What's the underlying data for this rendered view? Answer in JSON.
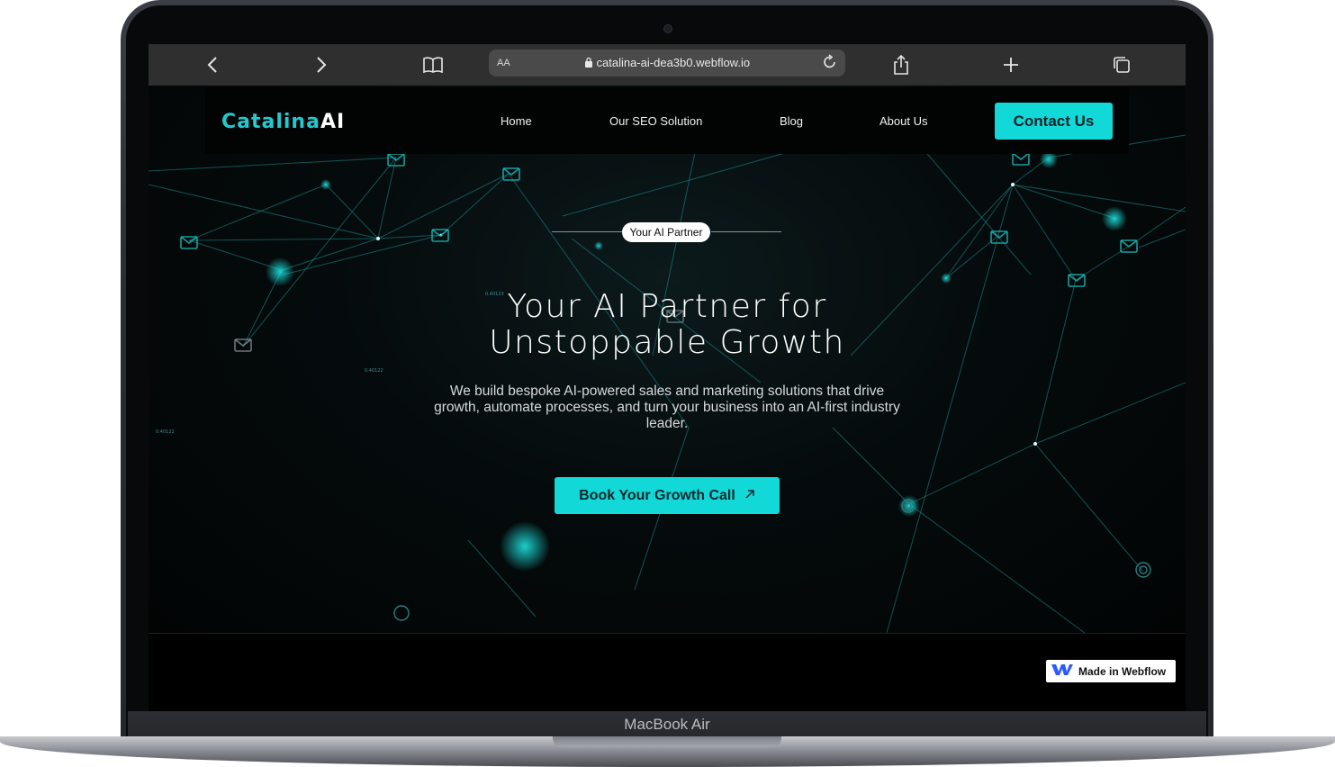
{
  "device": {
    "label": "MacBook Air"
  },
  "browser": {
    "url": "catalina-ai-dea3b0.webflow.io",
    "text_size_label": "AA",
    "icons": [
      "back-icon",
      "forward-icon",
      "bookmarks-icon",
      "lock-icon",
      "reload-icon",
      "share-icon",
      "new-tab-icon",
      "tabs-icon"
    ]
  },
  "nav": {
    "logo_text_1": "Catalina",
    "logo_text_2": "AI",
    "links": [
      {
        "label": "Home"
      },
      {
        "label": "Our SEO Solution"
      },
      {
        "label": "Blog"
      },
      {
        "label": "About Us"
      }
    ],
    "cta": "Contact Us"
  },
  "hero": {
    "pill": "Your AI Partner",
    "headline_line1": "Your AI Partner for",
    "headline_line2": "Unstoppable Growth",
    "subtitle": "We build bespoke AI-powered sales and marketing solutions that drive growth, automate processes, and turn your business into an AI-first industry leader.",
    "cta_label": "Book Your Growth Call",
    "cta_icon": "arrow-up-right-icon"
  },
  "background_labels": [
    "0.40122",
    "0.40122",
    "0.40123"
  ],
  "badge": {
    "label": "Made in Webflow",
    "icon": "webflow-logo-icon"
  },
  "colors": {
    "accent": "#12d8d8",
    "background": "#020404",
    "nav_bg": "#020303"
  }
}
